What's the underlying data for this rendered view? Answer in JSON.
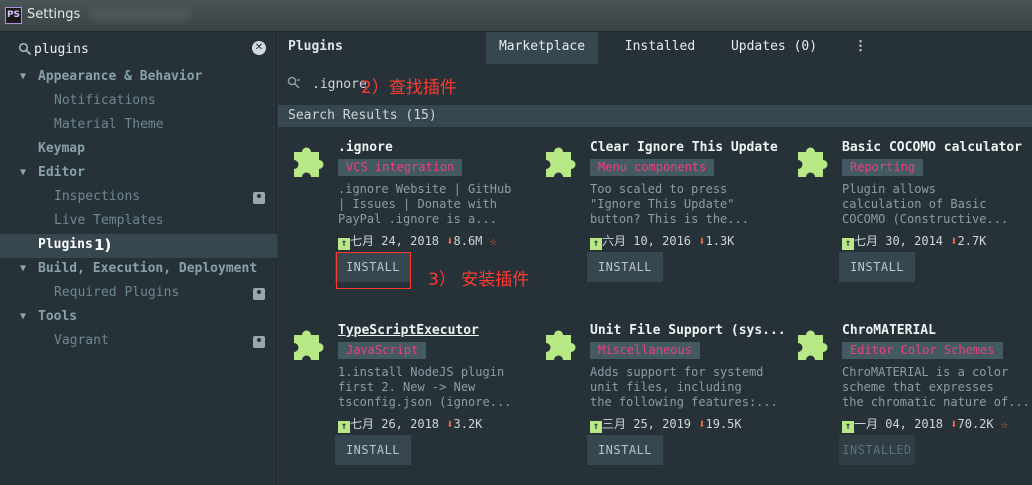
{
  "window": {
    "title": "Settings",
    "app_icon": "PS"
  },
  "sidebar": {
    "search_value": "plugins",
    "tree": [
      {
        "label": "Appearance & Behavior",
        "level": 0,
        "expanded": true
      },
      {
        "label": "Notifications",
        "level": 1
      },
      {
        "label": "Material Theme",
        "level": 1
      },
      {
        "label": "Keymap",
        "level": 0
      },
      {
        "label": "Editor",
        "level": 0,
        "expanded": true
      },
      {
        "label": "Inspections",
        "level": 1,
        "badge": true
      },
      {
        "label": "Live Templates",
        "level": 1
      },
      {
        "label": "Plugins",
        "level": 0,
        "selected": true,
        "annotation": "1)"
      },
      {
        "label": "Build, Execution, Deployment",
        "level": 0,
        "expanded": true
      },
      {
        "label": "Required Plugins",
        "level": 1,
        "badge": true
      },
      {
        "label": "Tools",
        "level": 0,
        "expanded": true
      },
      {
        "label": "Vagrant",
        "level": 1,
        "badge": true
      }
    ]
  },
  "main": {
    "heading": "Plugins",
    "tabs": [
      {
        "label": "Marketplace",
        "active": true
      },
      {
        "label": "Installed"
      },
      {
        "label": "Updates (0)"
      }
    ],
    "kebab": "⋮",
    "search": {
      "value": ".ignore",
      "annotation": "2）查找插件"
    },
    "results_label": "Search Results (15)",
    "plugins": [
      {
        "name": ".ignore",
        "category": "VCS integration",
        "desc": ".ignore Website | GitHub\n| Issues | Donate with\nPayPal .ignore is a...",
        "date": "七月 24, 2018",
        "downloads": "8.6M",
        "star": true,
        "button": "INSTALL",
        "highlight": true,
        "annotation": "3） 安装插件"
      },
      {
        "name": "Clear Ignore This Update",
        "category": "Menu components",
        "desc": "Too scaled to press\n\"Ignore This Update\"\nbutton? This is the...",
        "date": "六月 10, 2016",
        "downloads": "1.3K",
        "button": "INSTALL"
      },
      {
        "name": "Basic COCOMO calculator",
        "category": "Reporting",
        "desc": "Plugin allows\ncalculation of Basic\nCOCOMO (Constructive...",
        "date": "七月 30, 2014",
        "downloads": "2.7K",
        "button": "INSTALL"
      },
      {
        "name": "TypeScriptExecutor",
        "category": "JavaScript",
        "desc": "1.install NodeJS plugin\nfirst 2. New -> New\ntsconfig.json (ignore...",
        "date": "七月 26, 2018",
        "downloads": "3.2K",
        "button": "INSTALL",
        "link": true
      },
      {
        "name": "Unit File Support (sys...",
        "category": "Miscellaneous",
        "desc": "Adds support for systemd\nunit files, including\nthe following features:...",
        "date": "三月 25, 2019",
        "downloads": "19.5K",
        "button": "INSTALL"
      },
      {
        "name": "ChroMATERIAL",
        "category": "Editor Color Schemes",
        "desc": "ChroMATERIAL is a color\nscheme that expresses\nthe chromatic nature of...",
        "date": "一月 04, 2018",
        "downloads": "70.2K",
        "star": true,
        "button": "INSTALLED",
        "disabled": true
      }
    ]
  },
  "colors": {
    "accent_red": "#ff3b30",
    "category_pink": "#e9427a",
    "puzzle_green": "#b8e986",
    "download_orange": "#ff7043"
  }
}
